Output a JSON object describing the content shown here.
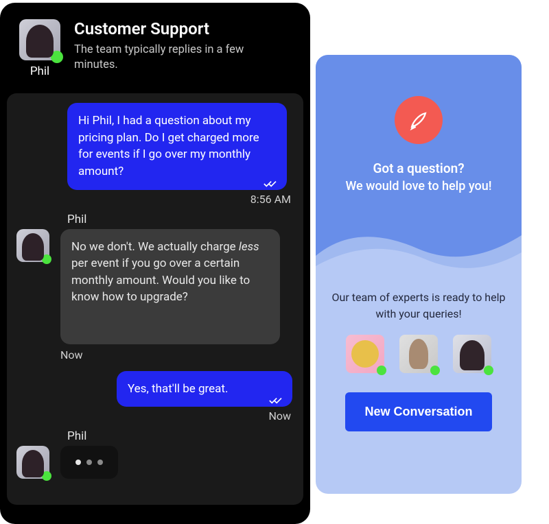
{
  "chat": {
    "header": {
      "title": "Customer Support",
      "subtitle": "The team typically replies in a few minutes.",
      "agent_name": "Phil"
    },
    "messages": {
      "m1": {
        "text": "Hi Phil, I had a question about my pricing plan. Do I get charged more for events if I go over my monthly amount?",
        "time": "8:56 AM"
      },
      "m2": {
        "sender": "Phil",
        "text_before": "No we don't. We actually charge ",
        "text_italic": "less",
        "text_after": " per event if you go over a certain monthly amount. Would you like to know how to upgrade?",
        "time": "Now"
      },
      "m3": {
        "text": "Yes, that'll be great.",
        "time": "Now"
      },
      "m4": {
        "sender": "Phil"
      }
    }
  },
  "promo": {
    "heading": "Got a question?",
    "subheading": "We would love to help you!",
    "body": "Our team of experts is ready to help with your queries!",
    "button": "New Conversation"
  }
}
